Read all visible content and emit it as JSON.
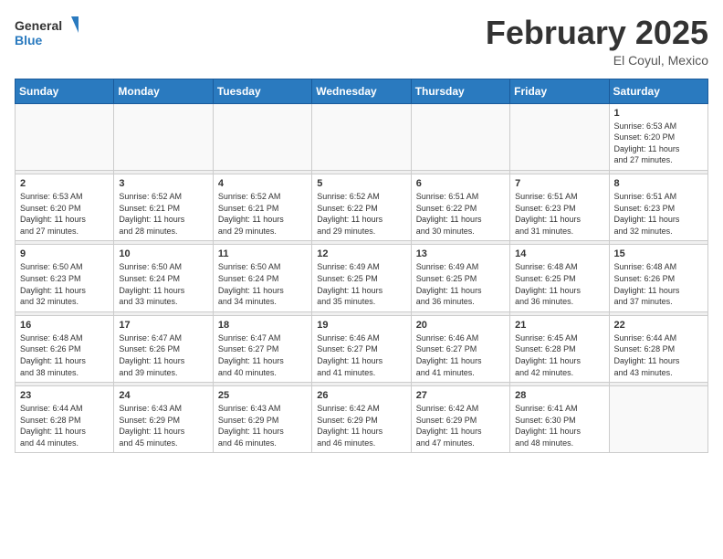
{
  "header": {
    "logo_general": "General",
    "logo_blue": "Blue",
    "title": "February 2025",
    "location": "El Coyul, Mexico"
  },
  "calendar": {
    "days_of_week": [
      "Sunday",
      "Monday",
      "Tuesday",
      "Wednesday",
      "Thursday",
      "Friday",
      "Saturday"
    ],
    "weeks": [
      {
        "days": [
          {
            "num": "",
            "info": ""
          },
          {
            "num": "",
            "info": ""
          },
          {
            "num": "",
            "info": ""
          },
          {
            "num": "",
            "info": ""
          },
          {
            "num": "",
            "info": ""
          },
          {
            "num": "",
            "info": ""
          },
          {
            "num": "1",
            "info": "Sunrise: 6:53 AM\nSunset: 6:20 PM\nDaylight: 11 hours\nand 27 minutes."
          }
        ]
      },
      {
        "days": [
          {
            "num": "2",
            "info": "Sunrise: 6:53 AM\nSunset: 6:20 PM\nDaylight: 11 hours\nand 27 minutes."
          },
          {
            "num": "3",
            "info": "Sunrise: 6:52 AM\nSunset: 6:21 PM\nDaylight: 11 hours\nand 28 minutes."
          },
          {
            "num": "4",
            "info": "Sunrise: 6:52 AM\nSunset: 6:21 PM\nDaylight: 11 hours\nand 29 minutes."
          },
          {
            "num": "5",
            "info": "Sunrise: 6:52 AM\nSunset: 6:22 PM\nDaylight: 11 hours\nand 29 minutes."
          },
          {
            "num": "6",
            "info": "Sunrise: 6:51 AM\nSunset: 6:22 PM\nDaylight: 11 hours\nand 30 minutes."
          },
          {
            "num": "7",
            "info": "Sunrise: 6:51 AM\nSunset: 6:23 PM\nDaylight: 11 hours\nand 31 minutes."
          },
          {
            "num": "8",
            "info": "Sunrise: 6:51 AM\nSunset: 6:23 PM\nDaylight: 11 hours\nand 32 minutes."
          }
        ]
      },
      {
        "days": [
          {
            "num": "9",
            "info": "Sunrise: 6:50 AM\nSunset: 6:23 PM\nDaylight: 11 hours\nand 32 minutes."
          },
          {
            "num": "10",
            "info": "Sunrise: 6:50 AM\nSunset: 6:24 PM\nDaylight: 11 hours\nand 33 minutes."
          },
          {
            "num": "11",
            "info": "Sunrise: 6:50 AM\nSunset: 6:24 PM\nDaylight: 11 hours\nand 34 minutes."
          },
          {
            "num": "12",
            "info": "Sunrise: 6:49 AM\nSunset: 6:25 PM\nDaylight: 11 hours\nand 35 minutes."
          },
          {
            "num": "13",
            "info": "Sunrise: 6:49 AM\nSunset: 6:25 PM\nDaylight: 11 hours\nand 36 minutes."
          },
          {
            "num": "14",
            "info": "Sunrise: 6:48 AM\nSunset: 6:25 PM\nDaylight: 11 hours\nand 36 minutes."
          },
          {
            "num": "15",
            "info": "Sunrise: 6:48 AM\nSunset: 6:26 PM\nDaylight: 11 hours\nand 37 minutes."
          }
        ]
      },
      {
        "days": [
          {
            "num": "16",
            "info": "Sunrise: 6:48 AM\nSunset: 6:26 PM\nDaylight: 11 hours\nand 38 minutes."
          },
          {
            "num": "17",
            "info": "Sunrise: 6:47 AM\nSunset: 6:26 PM\nDaylight: 11 hours\nand 39 minutes."
          },
          {
            "num": "18",
            "info": "Sunrise: 6:47 AM\nSunset: 6:27 PM\nDaylight: 11 hours\nand 40 minutes."
          },
          {
            "num": "19",
            "info": "Sunrise: 6:46 AM\nSunset: 6:27 PM\nDaylight: 11 hours\nand 41 minutes."
          },
          {
            "num": "20",
            "info": "Sunrise: 6:46 AM\nSunset: 6:27 PM\nDaylight: 11 hours\nand 41 minutes."
          },
          {
            "num": "21",
            "info": "Sunrise: 6:45 AM\nSunset: 6:28 PM\nDaylight: 11 hours\nand 42 minutes."
          },
          {
            "num": "22",
            "info": "Sunrise: 6:44 AM\nSunset: 6:28 PM\nDaylight: 11 hours\nand 43 minutes."
          }
        ]
      },
      {
        "days": [
          {
            "num": "23",
            "info": "Sunrise: 6:44 AM\nSunset: 6:28 PM\nDaylight: 11 hours\nand 44 minutes."
          },
          {
            "num": "24",
            "info": "Sunrise: 6:43 AM\nSunset: 6:29 PM\nDaylight: 11 hours\nand 45 minutes."
          },
          {
            "num": "25",
            "info": "Sunrise: 6:43 AM\nSunset: 6:29 PM\nDaylight: 11 hours\nand 46 minutes."
          },
          {
            "num": "26",
            "info": "Sunrise: 6:42 AM\nSunset: 6:29 PM\nDaylight: 11 hours\nand 46 minutes."
          },
          {
            "num": "27",
            "info": "Sunrise: 6:42 AM\nSunset: 6:29 PM\nDaylight: 11 hours\nand 47 minutes."
          },
          {
            "num": "28",
            "info": "Sunrise: 6:41 AM\nSunset: 6:30 PM\nDaylight: 11 hours\nand 48 minutes."
          },
          {
            "num": "",
            "info": ""
          }
        ]
      }
    ]
  }
}
